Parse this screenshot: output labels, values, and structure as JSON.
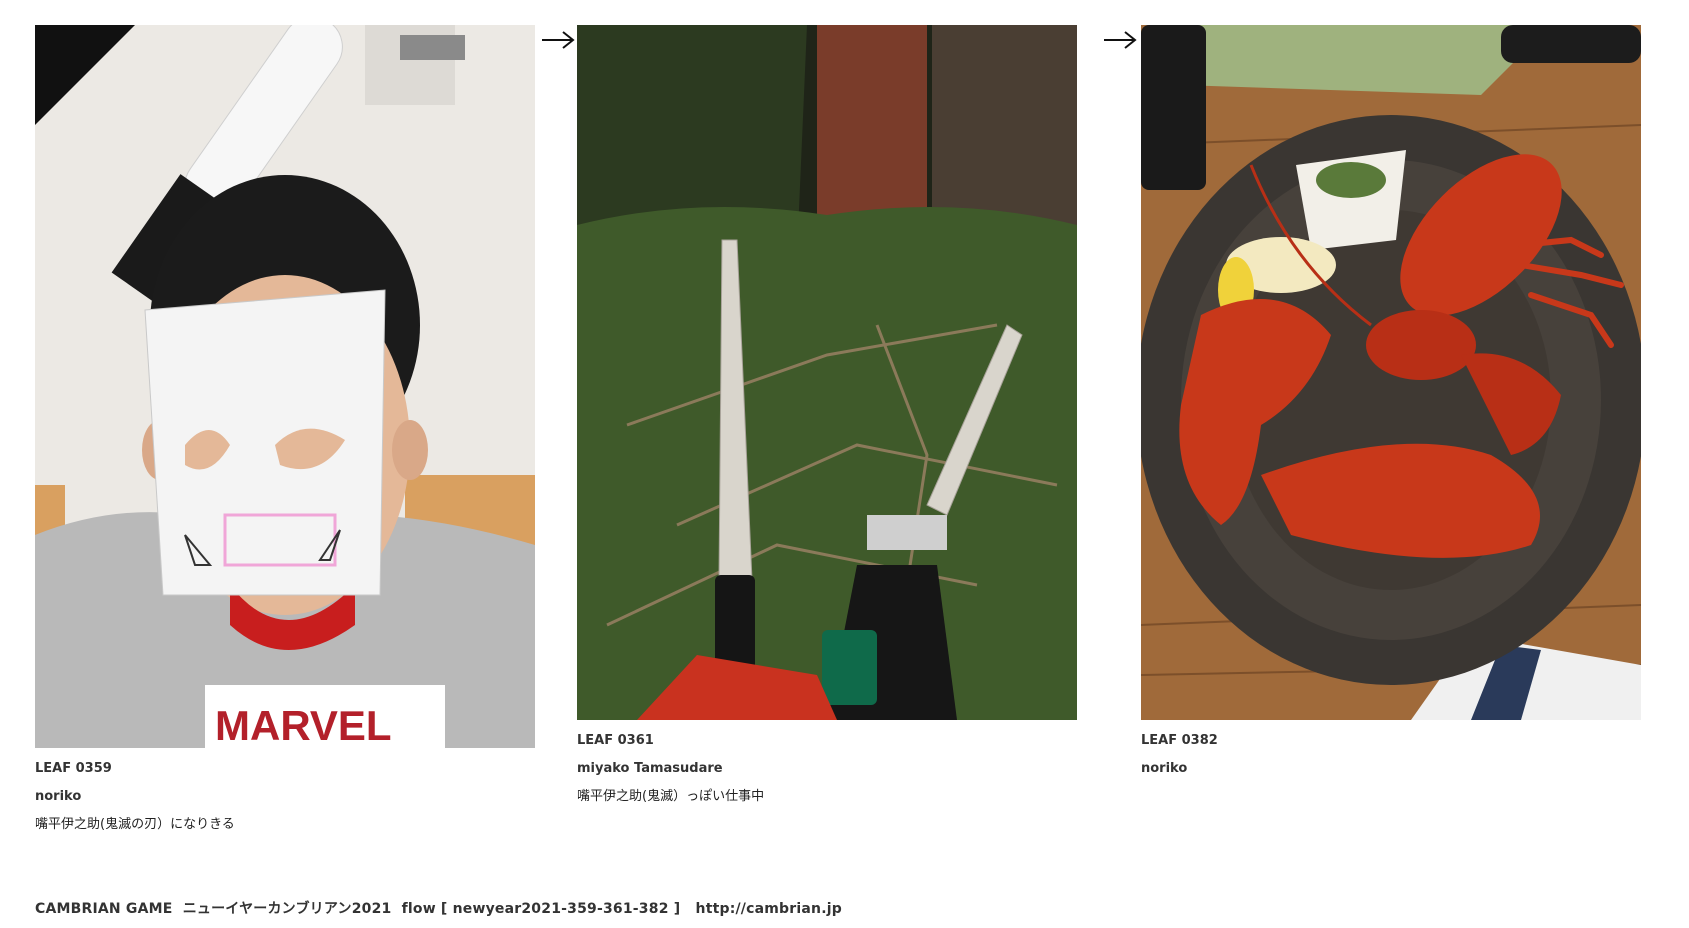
{
  "leaves": [
    {
      "id": "LEAF 0359",
      "author": "noriko",
      "comment": "嘴平伊之助(鬼滅の刃）になりきる"
    },
    {
      "id": "LEAF 0361",
      "author": "miyako Tamasudare",
      "comment": "嘴平伊之助(鬼滅）っぽい仕事中"
    },
    {
      "id": "LEAF 0382",
      "author": "noriko",
      "comment": ""
    }
  ],
  "arrow_icon": "right-arrow-icon",
  "footer": {
    "text": "CAMBRIAN GAME  ニューイヤーカンブリアン2021  flow [ newyear2021-359-361-382 ]   http://cambrian.jp"
  },
  "colors": {
    "lobster": "#c8381a",
    "plate": "#3a3632",
    "foliage": "#3f5a2a"
  }
}
